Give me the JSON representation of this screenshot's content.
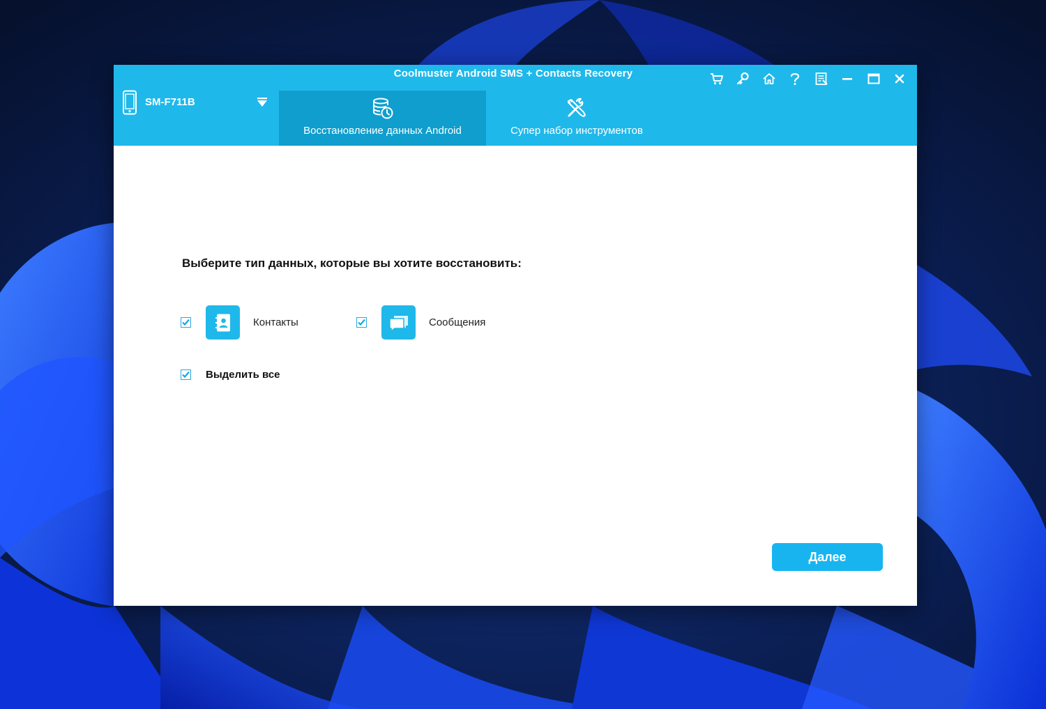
{
  "window": {
    "title": "Coolmuster Android SMS + Contacts Recovery",
    "controls": [
      {
        "name": "cart-icon",
        "label": "cart"
      },
      {
        "name": "key-icon",
        "label": "register"
      },
      {
        "name": "home-icon",
        "label": "home"
      },
      {
        "name": "help-icon",
        "label": "help"
      },
      {
        "name": "feedback-icon",
        "label": "feedback"
      },
      {
        "name": "minimize-icon",
        "label": "minimize"
      },
      {
        "name": "maximize-icon",
        "label": "maximize"
      },
      {
        "name": "close-icon",
        "label": "close"
      }
    ]
  },
  "device": {
    "name": "SM-F711B",
    "icon": "phone-icon"
  },
  "tabs": [
    {
      "label": "Восстановление данных Android",
      "icon": "database-restore-icon",
      "active": true
    },
    {
      "label": "Супер набор инструментов",
      "icon": "tools-icon",
      "active": false
    }
  ],
  "main": {
    "prompt": "Выберите тип данных, которые вы хотите восстановить:",
    "options": [
      {
        "label": "Контакты",
        "icon": "contacts-book-icon",
        "checked": true
      },
      {
        "label": "Сообщения",
        "icon": "chat-bubbles-icon",
        "checked": true
      }
    ],
    "select_all": {
      "label": "Выделить все",
      "checked": true
    },
    "next_button": "Далее"
  },
  "colors": {
    "accent": "#1fb8ea",
    "active_tab": "#0f9ecd",
    "button": "#18b4f0"
  }
}
